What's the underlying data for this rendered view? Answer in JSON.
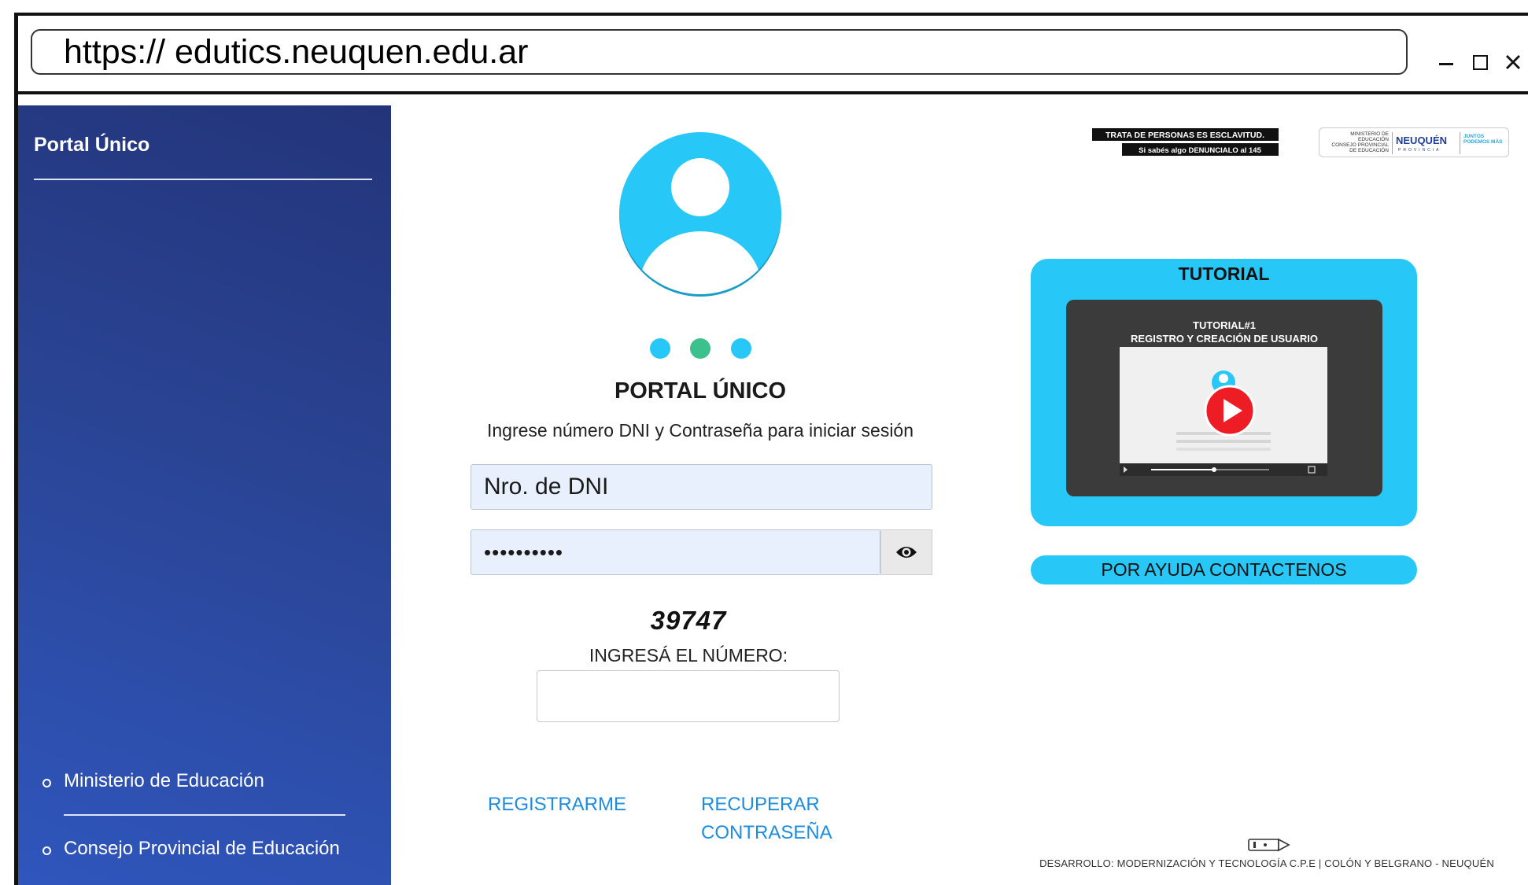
{
  "browser": {
    "url": "https:// edutics.neuquen.edu.ar",
    "controls": [
      "minimize",
      "maximize",
      "close"
    ]
  },
  "sidebar": {
    "title": "Portal Único",
    "items": [
      {
        "label": "Ministerio de Educación"
      },
      {
        "label": "Consejo Provincial de Educación"
      }
    ]
  },
  "login": {
    "title": "PORTAL ÚNICO",
    "subtitle": "Ingrese número DNI y Contraseña para iniciar sesión",
    "dni_value": "Nro. de DNI",
    "password_value": "••••••••••",
    "step_dots": [
      "#27c8f7",
      "#3cc08c",
      "#27c8f7"
    ],
    "captcha_code": "39747",
    "captcha_label": "INGRESÁ EL NÚMERO:",
    "captcha_value": "",
    "register_link": "REGISTRARME",
    "recover_link": "RECUPERAR CONTRASEÑA"
  },
  "banners": {
    "trata_line1": "TRATA DE PERSONAS ES ESCLAVITUD.",
    "trata_line2": "Si sabés algo DENUNCIALO al 145",
    "ministry_line1": "MINISTERIO DE EDUCACIÓN",
    "ministry_line2": "CONSEJO PROVINCIAL DE EDUCACIÓN",
    "neuquen": "NEUQUÉN",
    "provincia": "PROVINCIA",
    "juntos": "JUNTOS PODEMOS MÁS"
  },
  "tutorial": {
    "heading": "TUTORIAL",
    "video_title_1": "TUTORIAL#1",
    "video_title_2": "REGISTRO Y CREACIÓN DE USUARIO"
  },
  "help_button": "POR AYUDA CONTACTENOS",
  "footer": {
    "credit": "DESARROLLO: MODERNIZACIÓN Y TECNOLOGÍA C.P.E | COLÓN Y BELGRANO - NEUQUÉN"
  },
  "colors": {
    "accent": "#27c8f7",
    "sidebar_top": "#23347a",
    "sidebar_bottom": "#2f56bd",
    "link": "#1c8de0",
    "input_bg": "#e8f0fe"
  }
}
